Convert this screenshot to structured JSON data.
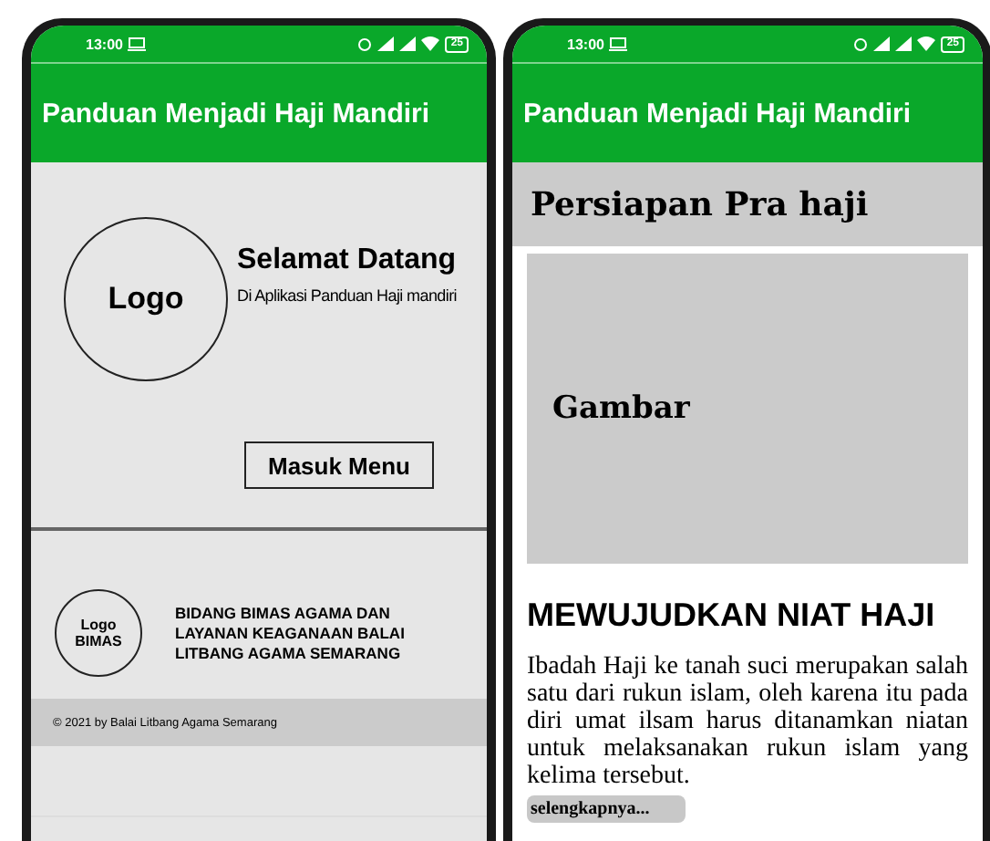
{
  "phones": [
    {
      "status_bar": {
        "time": "13:00",
        "battery": "25"
      },
      "app_bar": {
        "title": "Panduan Menjadi Haji Mandiri"
      },
      "kind": "home",
      "welcome": {
        "logo": "Logo",
        "title": "Selamat Datang",
        "subtitle": "Di Aplikasi Panduan Haji mandiri",
        "button": "Masuk Menu"
      },
      "footer": {
        "logo_lines": [
          "Logo",
          "BIMAS"
        ],
        "institution_lines": [
          "BIDANG BIMAS AGAMA DAN",
          "LAYANAN KEAGANAAN BALAI",
          "LITBANG AGAMA SEMARANG"
        ],
        "copyright": "© 2021 by Balai Litbang Agama Semarang"
      }
    },
    {
      "status_bar": {
        "time": "13:00",
        "battery": "25"
      },
      "app_bar": {
        "title": "Panduan Menjadi Haji Mandiri"
      },
      "kind": "article",
      "section_title": "Persiapan Pra haji",
      "image_label": "Gambar",
      "heading": "MEWUJUDKAN NIAT HAJI",
      "paragraph": "Ibadah Haji ke tanah suci merupakan salah satu dari rukun islam, oleh karena itu pada diri umat ilsam harus ditanamkan niatan untuk melaksanakan rukun islam yang kelima tersebut.",
      "more_button": "selengkapnya..."
    }
  ]
}
